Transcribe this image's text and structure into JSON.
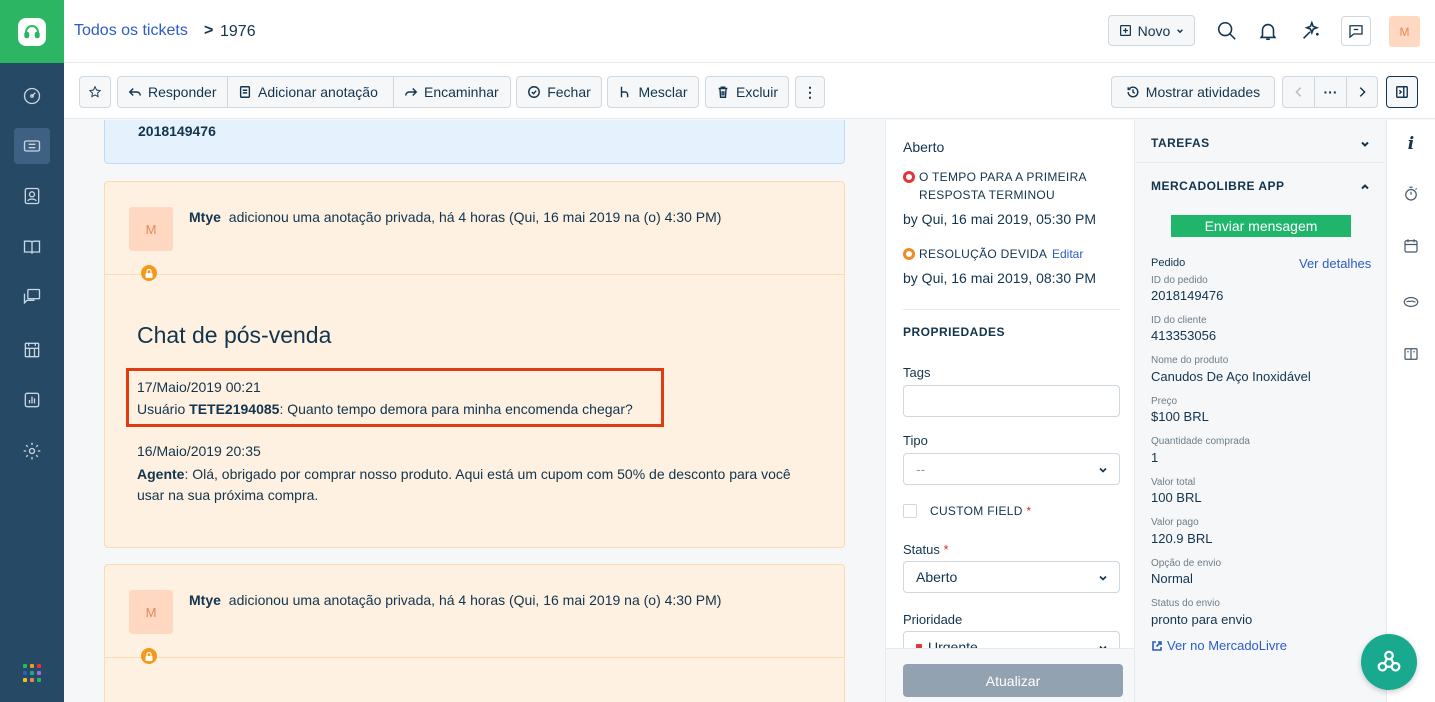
{
  "header": {
    "breadcrumb_link": "Todos os tickets",
    "breadcrumb_sep": ">",
    "ticket_id": "1976",
    "new_label": "Novo",
    "profile_initial": "M"
  },
  "toolbar": {
    "reply": "Responder",
    "add_note": "Adicionar anotação",
    "forward": "Encaminhar",
    "close": "Fechar",
    "merge": "Mesclar",
    "delete": "Excluir",
    "more": "⋮",
    "show_activities": "Mostrar atividades",
    "pager_more": "···"
  },
  "conversation": {
    "email_order_number": "2018149476",
    "notes": [
      {
        "author_initial": "M",
        "author": "Mtye",
        "action": "adicionou uma anotação privada, há 4 horas (Qui, 16 mai 2019 na (o) 4:30 PM)",
        "title": "Chat de pós-venda",
        "messages": [
          {
            "date": "17/Maio/2019 00:21",
            "prefix": "Usuário",
            "sender": "TETE2194085",
            "text": ": Quanto tempo demora para minha encomenda chegar?"
          },
          {
            "date": "16/Maio/2019 20:35",
            "prefix": "",
            "sender": "Agente",
            "text": ": Olá, obrigado por comprar nosso produto. Aqui está um cupom com 50% de desconto para você usar na sua próxima compra."
          }
        ]
      },
      {
        "author_initial": "M",
        "author": "Mtye",
        "action": "adicionou uma anotação privada, há 4 horas (Qui, 16 mai 2019 na (o) 4:30 PM)"
      }
    ]
  },
  "properties": {
    "status_heading": "Aberto",
    "sla_first_response": "O TEMPO PARA A PRIMEIRA RESPOSTA TERMINOU",
    "sla_first_response_time": "by Qui, 16 mai 2019, 05:30 PM",
    "sla_resolution": "RESOLUÇÃO DEVIDA",
    "edit_label": "Editar",
    "sla_resolution_time": "by Qui, 16 mai 2019, 08:30 PM",
    "section_title": "PROPRIEDADES",
    "tags_label": "Tags",
    "tags_value": "",
    "type_label": "Tipo",
    "type_value": "--",
    "custom_field_label": "CUSTOM FIELD",
    "required_mark": "*",
    "status_label": "Status",
    "status_value": "Aberto",
    "priority_label": "Prioridade",
    "priority_value": "Urgente",
    "update_button": "Atualizar"
  },
  "apps": {
    "tasks_title": "TAREFAS",
    "ml_title": "MERCADOLIBRE APP",
    "send_message": "Enviar mensagem",
    "order_label": "Pedido",
    "see_details": "Ver detalhes",
    "fields": [
      {
        "label": "ID do pedido",
        "value": "2018149476"
      },
      {
        "label": "ID do cliente",
        "value": "413353056"
      },
      {
        "label": "Nome do produto",
        "value": "Canudos De Aço Inoxidável"
      },
      {
        "label": "Preço",
        "value": "$100 BRL"
      },
      {
        "label": "Quantidade comprada",
        "value": "1"
      },
      {
        "label": "Valor total",
        "value": "100 BRL"
      },
      {
        "label": "Valor pago",
        "value": "120.9 BRL"
      },
      {
        "label": "Opção de envio",
        "value": "Normal"
      },
      {
        "label": "Status do envio",
        "value": "pronto para envio"
      }
    ],
    "ml_link": "Ver no MercadoLivre"
  },
  "colors": {
    "brand_green": "#2cb664",
    "nav_bg": "#264966",
    "link_blue": "#2c5cc5",
    "note_bg": "#fef1e1",
    "highlight_red": "#e03c14",
    "sla_red": "#e43538",
    "sla_orange": "#f08a24",
    "send_green": "#1fb66c",
    "fab_teal": "#18a98f"
  }
}
